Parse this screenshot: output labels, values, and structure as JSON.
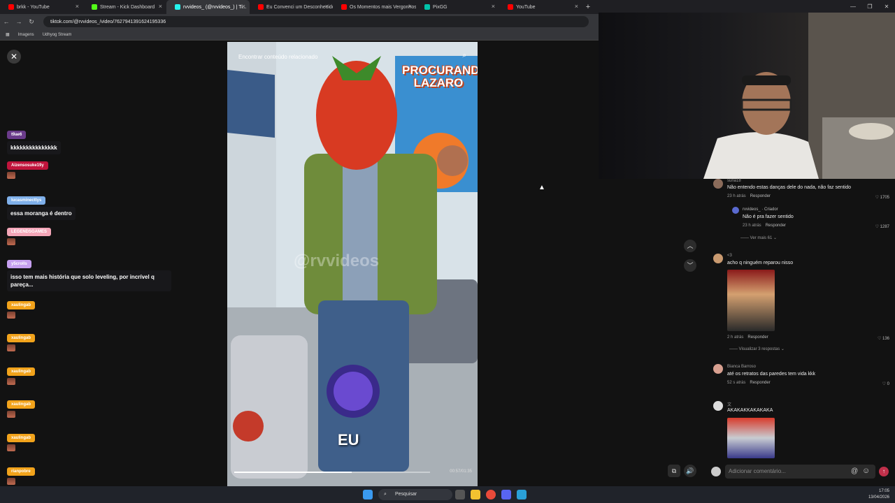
{
  "browser": {
    "tabs": [
      {
        "title": "brkk - YouTube",
        "color": "#ff0000",
        "active": false
      },
      {
        "title": "Stream - Kick Dashboard",
        "color": "#53fc18",
        "active": false
      },
      {
        "title": "rvvideos_ (@rvvideos_) | Ti...",
        "color": "#25f4ee",
        "active": true
      },
      {
        "title": "Eu Convenci um Desconhecido...",
        "color": "#ff0000",
        "active": false
      },
      {
        "title": "Os Momentos mais Vergonhosos...",
        "color": "#ff0000",
        "active": false
      },
      {
        "title": "PixGG",
        "color": "#00c2a8",
        "active": false
      },
      {
        "title": "YouTube",
        "color": "#ff0000",
        "active": false
      }
    ],
    "url": "tiktok.com/@rvvideos_/video/7627941391624195336",
    "bookmarks": [
      "Imagens",
      "Udhyog Stream"
    ]
  },
  "chat": [
    {
      "user": "t9ae6",
      "user_color": "#6a3b8a",
      "text": "kkkkkkkkkkkkkkk",
      "emote": false
    },
    {
      "user": "Aizensosuke19y",
      "user_color": "#c0143c",
      "text": "",
      "emote": true
    },
    {
      "user": "lucasminecttys",
      "user_color": "#7fb0ea",
      "text": "essa moranga é dentro",
      "emote": false
    },
    {
      "user": "LEGENDSGAMES",
      "user_color": "#f4a6b8",
      "text": "",
      "emote": true
    },
    {
      "user": "y5crolls",
      "user_color": "#c6a0f0",
      "text": "isso tem mais história que solo leveling, por incrível q pareça...",
      "emote": false
    },
    {
      "user": "xaulingab",
      "user_color": "#f2a31b",
      "text": "",
      "emote": true
    },
    {
      "user": "xaulingab",
      "user_color": "#f2a31b",
      "text": "",
      "emote": true
    },
    {
      "user": "xaulingab",
      "user_color": "#f2a31b",
      "text": "",
      "emote": true
    },
    {
      "user": "xaulingab",
      "user_color": "#f2a31b",
      "text": "",
      "emote": true
    },
    {
      "user": "xaulingab",
      "user_color": "#f2a31b",
      "text": "",
      "emote": true
    },
    {
      "user": "rianpobre",
      "user_color": "#f2a31b",
      "text": "",
      "emote": true
    }
  ],
  "video": {
    "top_label": "Encontrar conteúdo relacionado",
    "poster_title": "PROCURANDO LAZARO",
    "watermark": "@rvvideos",
    "caption": "EU",
    "time": "00:57/01:35",
    "progress": 0.6
  },
  "comments": [
    {
      "user": "suna18",
      "text": "Não entendo estas danças dele do nada, não faz sentido",
      "time": "23 h atrás",
      "reply": "Responder",
      "likes": "1705"
    },
    {
      "user": "rvvideos_ · Criador",
      "text": "Não é pra fazer sentido",
      "time": "23 h atrás",
      "reply": "Responder",
      "likes": "1287"
    },
    {
      "user": "<3",
      "text": "acho q ninguém reparou nisso",
      "time": "2 h atrás",
      "reply": "Responder",
      "likes": "136"
    },
    {
      "user": "Bianca Barroso",
      "text": "até os retratos das paredes tem vida kkk",
      "time": "52 s atrás",
      "reply": "Responder",
      "likes": "0"
    },
    {
      "user": "文",
      "text": "AKAKAKKAKAKAKA",
      "time": "",
      "reply": "",
      "likes": ""
    }
  ],
  "more_replies": "Ver mais 61",
  "view_replies": "Visualizar 3 respostas",
  "comment_placeholder": "Adicionar comentário...",
  "taskbar": {
    "search": "Pesquisar",
    "time": "17:05",
    "date": "13/04/2026"
  }
}
